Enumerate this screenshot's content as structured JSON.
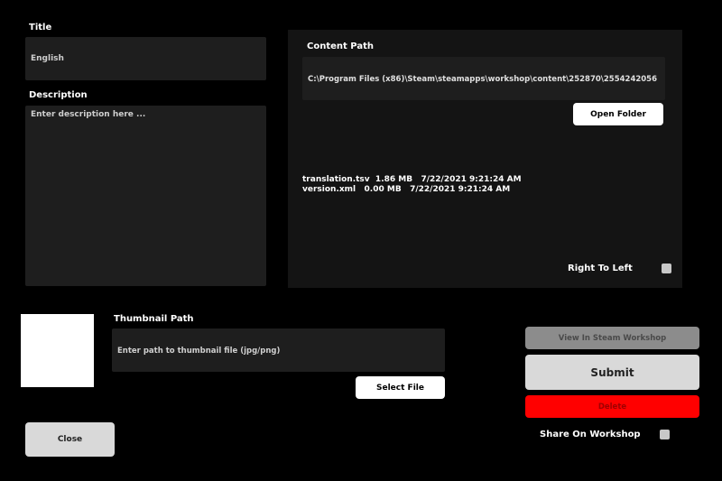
{
  "title": {
    "label": "Title",
    "value": "English"
  },
  "description": {
    "label": "Description",
    "placeholder": "Enter description here ..."
  },
  "content": {
    "label": "Content Path",
    "path": "C:\\Program Files (x86)\\Steam\\steamapps\\workshop\\content\\252870\\2554242056",
    "open_folder_label": "Open Folder",
    "files": [
      "translation.tsv  1.86 MB   7/22/2021 9:21:24 AM",
      "version.xml   0.00 MB   7/22/2021 9:21:24 AM"
    ],
    "rtl_label": "Right To Left"
  },
  "thumbnail": {
    "label": "Thumbnail Path",
    "placeholder": "Enter path to thumbnail file (jpg/png)",
    "select_label": "Select File"
  },
  "actions": {
    "view_workshop_label": "View In Steam Workshop",
    "submit_label": "Submit",
    "delete_label": "Delete",
    "share_label": "Share On Workshop",
    "close_label": "Close"
  },
  "colors": {
    "background": "#000000",
    "field": "#1e1e1e",
    "panel": "#141414",
    "delete": "#ff0000",
    "disabled_button": "#8c8c8c"
  }
}
